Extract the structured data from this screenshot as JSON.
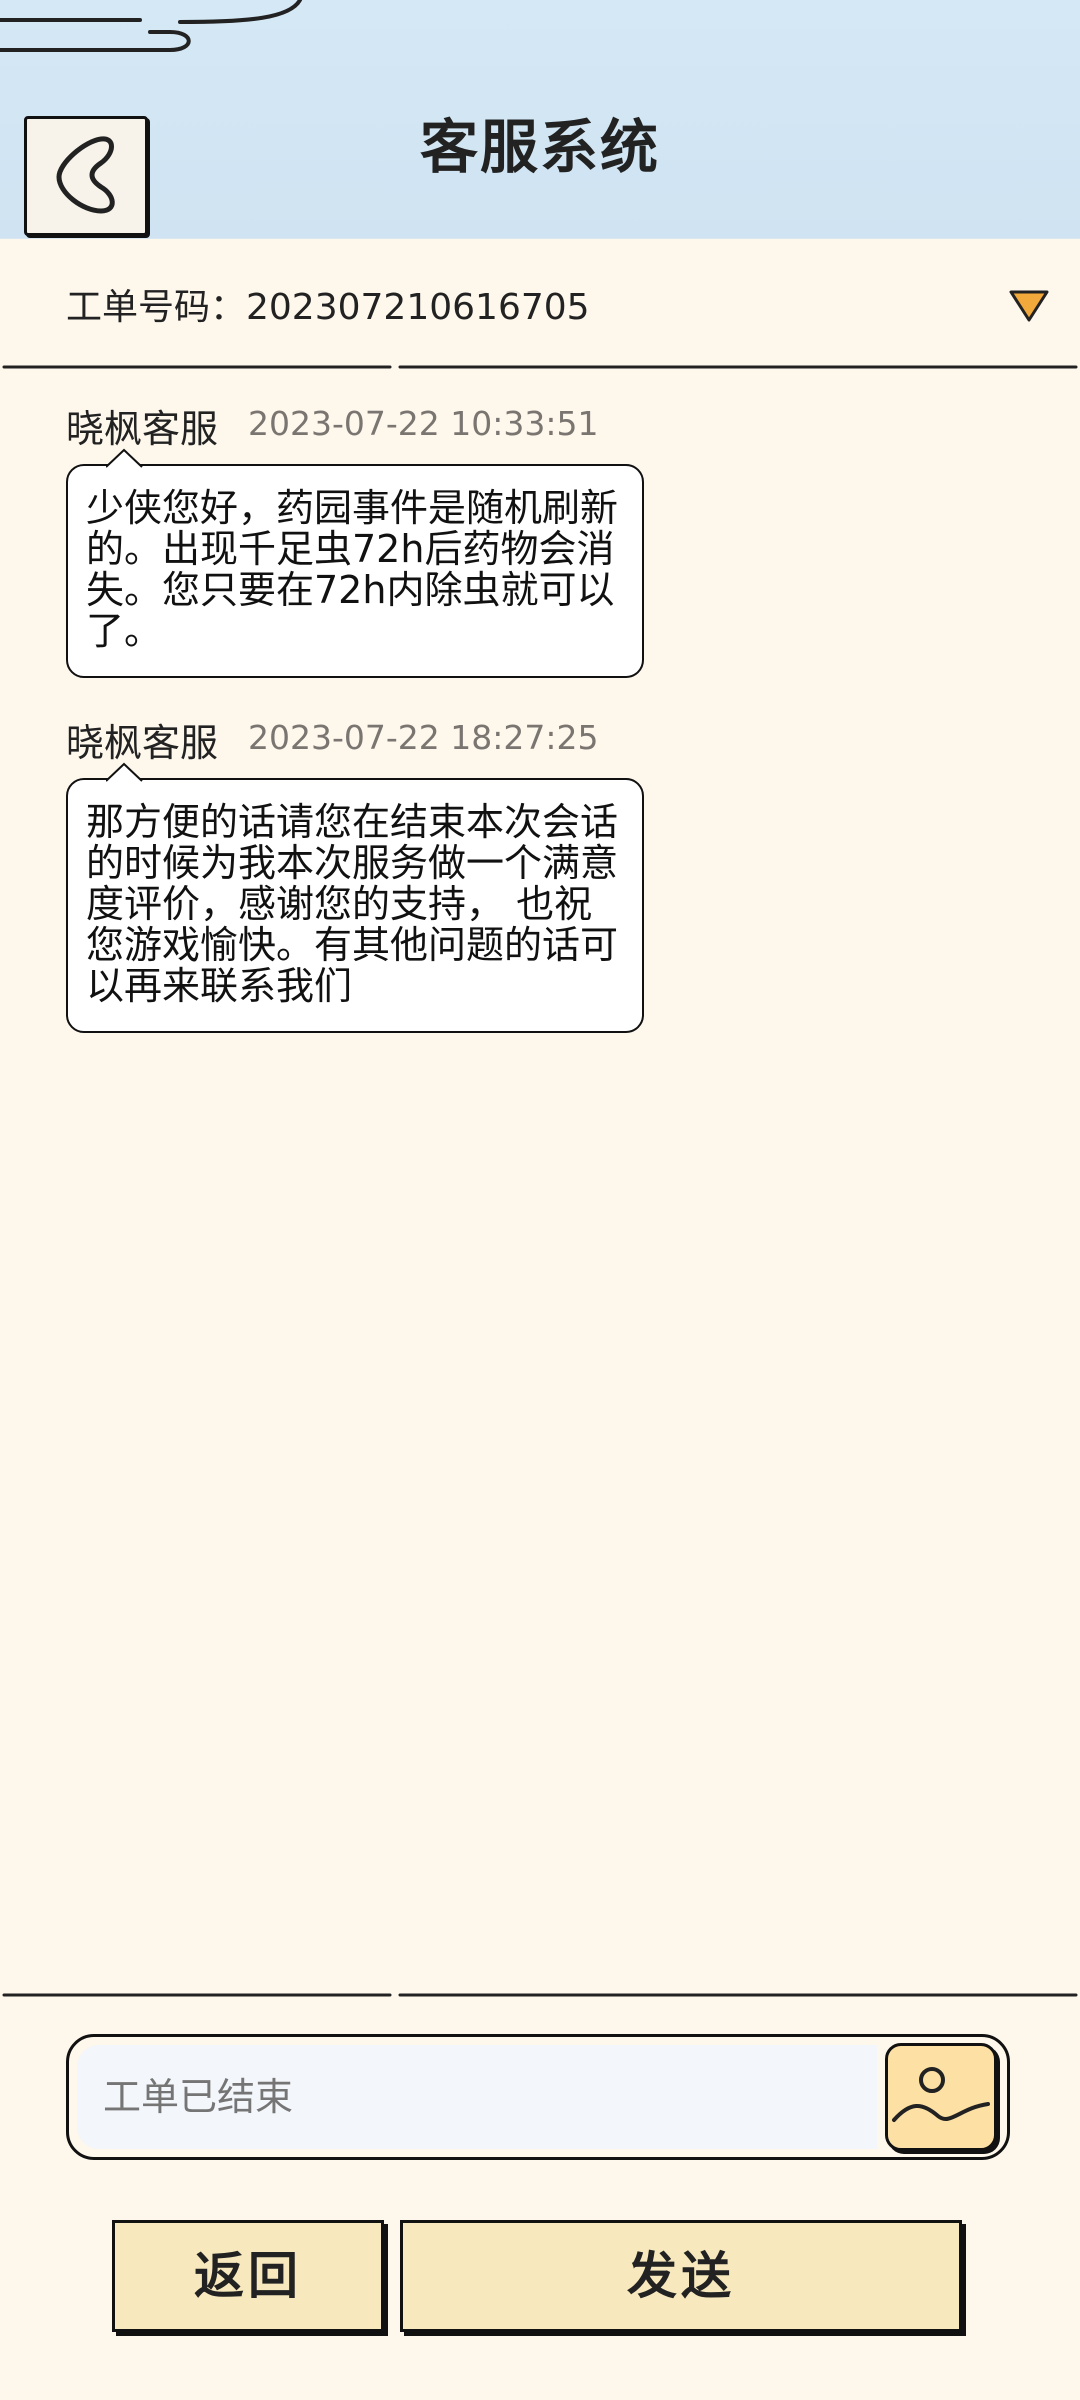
{
  "header": {
    "title": "客服系统",
    "back_icon": "back-chevron-icon"
  },
  "ticket": {
    "label": "工单号码：202307210616705",
    "toggle_icon": "triangle-down-icon",
    "toggle_color": "#f2a93b"
  },
  "messages": [
    {
      "sender": "晓枫客服",
      "time": "2023-07-22 10:33:51",
      "text": "少侠您好，药园事件是随机刷新的。出现千足虫72h后药物会消失。您只要在72h内除虫就可以了。"
    },
    {
      "sender": "晓枫客服",
      "time": "2023-07-22 18:27:25",
      "text": "那方便的话请您在结束本次会话的时候为我本次服务做一个满意度评价，感谢您的支持， 也祝您游戏愉快。有其他问题的话可以再来联系我们"
    }
  ],
  "composer": {
    "placeholder": "工单已结束",
    "image_icon": "image-upload-icon"
  },
  "buttons": {
    "back_label": "返回",
    "send_label": "发送"
  },
  "colors": {
    "header_bg": "#d5e8f5",
    "page_bg": "#fdf7ec",
    "button_bg": "#f7e8bd",
    "image_button_bg": "#fde0a4"
  }
}
